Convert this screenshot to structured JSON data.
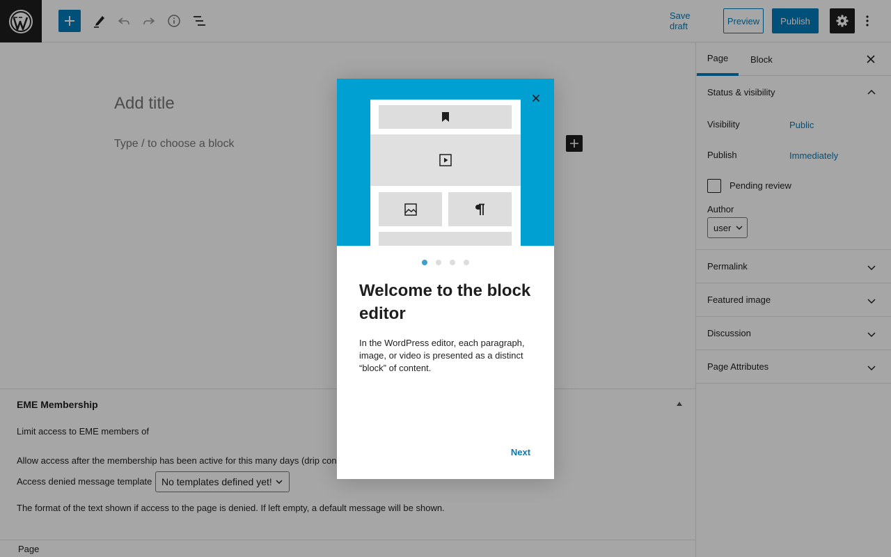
{
  "topbar": {
    "save_draft": "Save draft",
    "preview": "Preview",
    "publish": "Publish"
  },
  "editor": {
    "title_placeholder": "Add title",
    "block_placeholder": "Type / to choose a block"
  },
  "metabox": {
    "title": "EME Membership",
    "limit_text": "Limit access to EME members of",
    "drip_text": "Allow access after the membership has been active for this many days (drip con",
    "template_label": "Access denied message template",
    "template_value": "No templates defined yet!",
    "format_text": "The format of the text shown if access to the page is denied. If left empty, a default message will be shown."
  },
  "footer": {
    "breadcrumb": "Page"
  },
  "sidebar": {
    "tabs": [
      {
        "label": "Page",
        "active": true
      },
      {
        "label": "Block",
        "active": false
      }
    ],
    "status_visibility": {
      "title": "Status & visibility",
      "visibility_label": "Visibility",
      "visibility_value": "Public",
      "publish_label": "Publish",
      "publish_value": "Immediately",
      "pending_review_label": "Pending review",
      "pending_review_checked": false,
      "author_label": "Author",
      "author_value": "user"
    },
    "panels": [
      {
        "title": "Permalink"
      },
      {
        "title": "Featured image"
      },
      {
        "title": "Discussion"
      },
      {
        "title": "Page Attributes"
      }
    ]
  },
  "modal": {
    "heading": "Welcome to the block editor",
    "body": "In the WordPress editor, each paragraph, image, or video is presented as a distinct “block” of content.",
    "next_label": "Next",
    "page_count": 4,
    "current_page": 1,
    "hero_color": "#00a0d2",
    "hero_icons": [
      "bookmark-icon",
      "video-icon",
      "image-icon",
      "paragraph-icon"
    ]
  },
  "colors": {
    "accent": "#007cba",
    "dark": "#1e1e1e"
  }
}
